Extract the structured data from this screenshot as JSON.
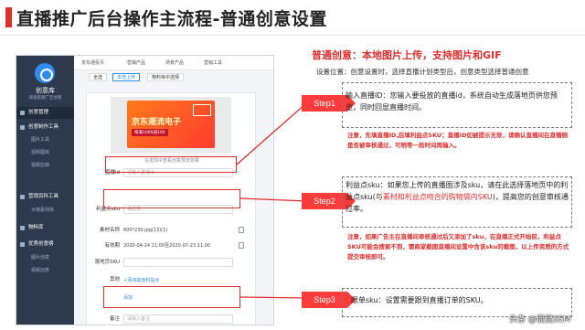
{
  "page": {
    "title": "直播推广后台操作主流程-普通创意设置",
    "heading": "普通创意：本地图片上传，支持图片和GIF",
    "subheading": "设置位置：创意设置时，选择直播计划类型后，创意类型选择普通创意"
  },
  "app": {
    "logo_text": "创意库",
    "logo_sub": "快速搭建广告创意",
    "sidebar": {
      "sections": [
        {
          "label": "创意管理",
          "active": true
        },
        {
          "label": "创意制作工具",
          "active": false
        },
        {
          "label": "营销百科工具",
          "active": false
        },
        {
          "label": "物料库",
          "active": false
        },
        {
          "label": "优秀创意榜",
          "active": false
        }
      ],
      "subs": [
        "图片工具",
        "视频图库",
        "视频剪辑",
        "大咖素材库",
        "图片创意",
        "视频创意"
      ]
    },
    "crumbs": [
      "京东通投页",
      "营销产品",
      "场景产品",
      "营销工具"
    ],
    "tabs": [
      "全选",
      "本地上传",
      "物料库中选择"
    ],
    "preview": {
      "banner_title": "京东潮流电子",
      "banner_sub": "每满1000减100",
      "caption": "在发现中查看创意预览效果"
    },
    "form": {
      "live_id": {
        "label": "直播id",
        "placeholder": "请输入直播id"
      },
      "sku": {
        "label": "利益点sku",
        "placeholder": "请选择"
      },
      "size": {
        "label": "素材名称",
        "value": "600*230.jpg(13)(1)"
      },
      "period": {
        "label": "有效期",
        "value": "2020-04-24 11:00至2020-07-23 11:00"
      },
      "dest_sku": {
        "label": "落地页SKU",
        "placeholder": ""
      },
      "other": {
        "label": "其他",
        "value": "添加"
      },
      "add_link": "+添加其他利益点",
      "remark": {
        "label": "备注",
        "placeholder": "请输入备注"
      }
    }
  },
  "steps": [
    {
      "label": "Step1",
      "text": "输入直播ID：您输入要投放的直播id，系统自动生成落地页供您预览，同时回显直播时间。",
      "note": "注意，先填直播ID,后填利益点SKU；直播ID如被提示无效，请确认直播间在直播侧是否被审核通过，可稍等一段时间再输入。"
    },
    {
      "label": "Step2",
      "text_before": "利益点sku：如果您上传的直播图涉及sku，请在此选择落地页中的利益点sku(与",
      "text_red": "素材和利益点吻合的购物袋内SKU",
      "text_after": ")，提高您的创意审核通过率。",
      "note": "注意，如果广告主在直播间审核通过后又添加了sku，在直播正式开始前，利益点SKU可能会搜索不到，需商家截图直播间设置中含该sku的截图，以上传资质的方式提交审核即可。"
    },
    {
      "label": "Step3",
      "text": "跟单sku：设置需要跟到直播订单的SKU。"
    }
  ],
  "watermark": "头条 @侃侃SEM",
  "colors": {
    "accent": "#e02d2d",
    "link": "#2f8cf0",
    "sidebar": "#2d3a4e"
  }
}
